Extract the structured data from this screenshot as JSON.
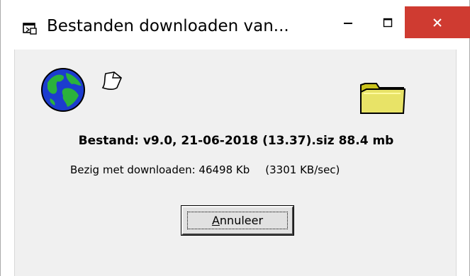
{
  "window": {
    "title": "Bestanden downloaden van...",
    "controls": {
      "minimize_icon": "minimize-icon",
      "maximize_icon": "maximize-icon",
      "close_icon": "close-icon",
      "close_color": "#cf3b31"
    }
  },
  "dialog": {
    "icons": [
      "globe-icon",
      "paper-icon",
      "folder-icon"
    ],
    "file_line": "Bestand: v9.0, 21-06-2018 (13.37).siz 88.4 mb",
    "progress_text": "Bezig met downloaden: 46498 Kb",
    "speed_text": "(3301 KB/sec)",
    "cancel_button": {
      "accelerator": "A",
      "rest": "nnuleer"
    }
  }
}
